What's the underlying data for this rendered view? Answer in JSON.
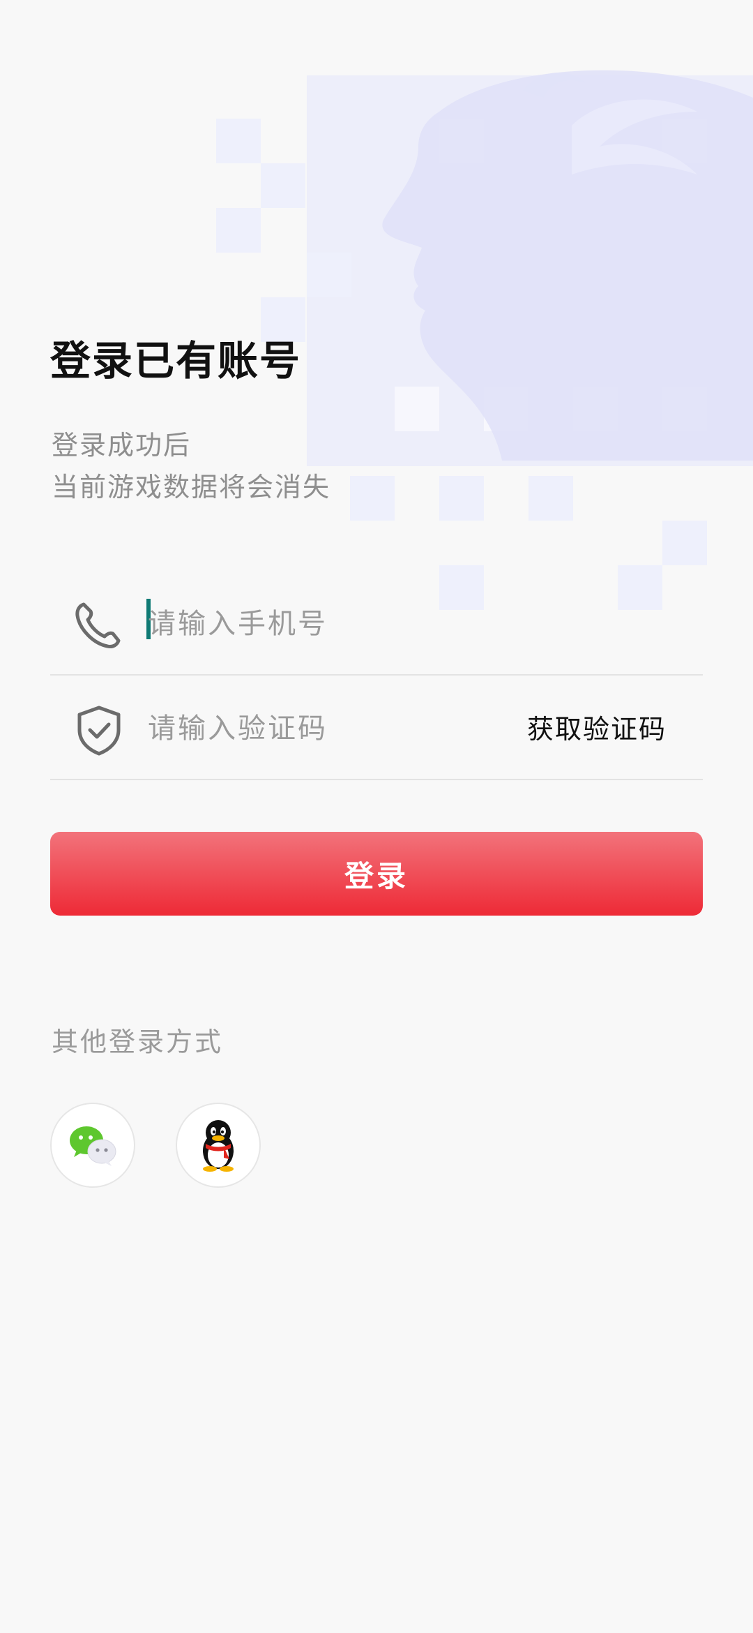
{
  "page": {
    "title": "登录已有账号",
    "subtitle_line1": "登录成功后",
    "subtitle_line2": "当前游戏数据将会消失"
  },
  "form": {
    "phone_placeholder": "请输入手机号",
    "phone_value": "",
    "code_placeholder": "请输入验证码",
    "code_value": "",
    "get_code_label": "获取验证码",
    "login_label": "登录"
  },
  "other": {
    "label": "其他登录方式",
    "methods": [
      {
        "icon": "wechat-icon"
      },
      {
        "icon": "qq-icon"
      }
    ]
  },
  "colors": {
    "accent_red": "#ee2a36",
    "caret": "#0f7a74",
    "muted_text": "#9a9a9a"
  }
}
